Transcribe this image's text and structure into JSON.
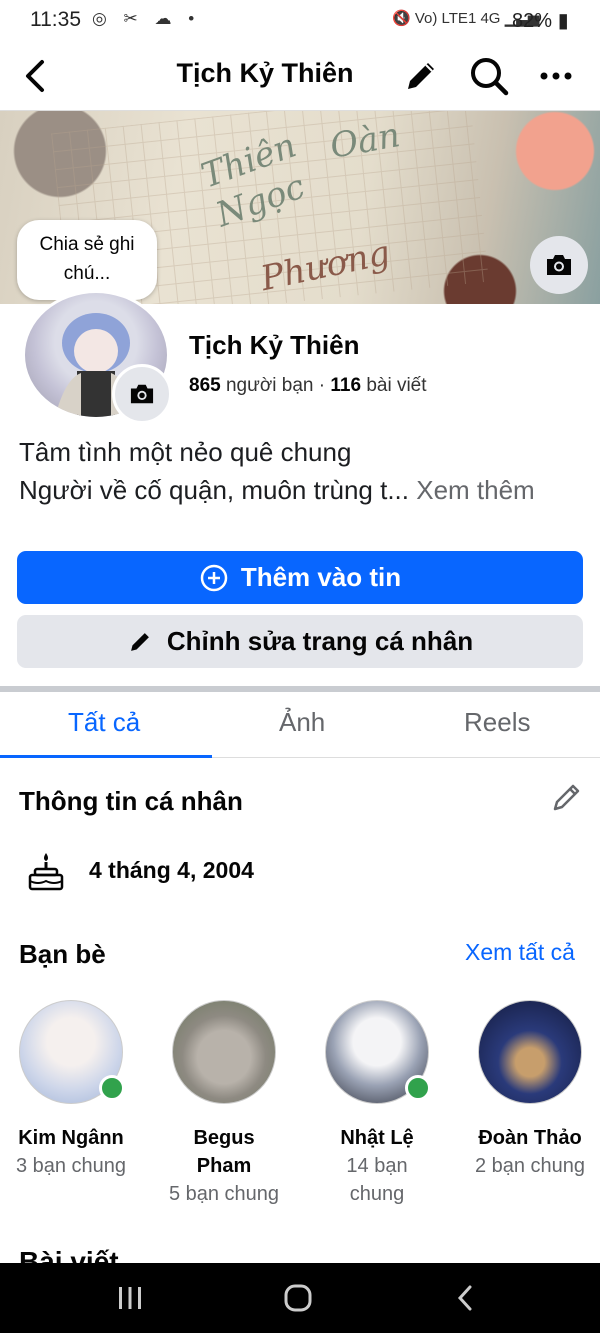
{
  "status_bar": {
    "time": "11:35",
    "left_icons": "◎ ✂ ☁ •",
    "network": "Vo) LTE1 4G",
    "battery": "82%"
  },
  "header": {
    "title": "Tịch Kỷ Thiên",
    "back_icon": "chevron-left-icon",
    "edit_icon": "pencil-icon",
    "search_icon": "search-icon",
    "more_icon": "more-dots-icon"
  },
  "cover": {
    "script_words": [
      "Thiên",
      "Ngọc",
      "Oàn",
      "Phương"
    ]
  },
  "note_bubble": {
    "line1": "Chia sẻ ghi",
    "line2": "chú..."
  },
  "profile": {
    "name": "Tịch Kỷ Thiên",
    "friends_count": "865",
    "friends_label": " người bạn · ",
    "posts_count": "116",
    "posts_label": " bài viết"
  },
  "bio": {
    "line1": "Tâm tình một nẻo quê chung",
    "line2": "Người về cố quận, muôn trùng t...",
    "see_more": " Xem thêm"
  },
  "actions": {
    "add_story": "Thêm vào tin",
    "edit_profile": "Chỉnh sửa trang cá nhân"
  },
  "tabs": [
    {
      "label": "Tất cả",
      "active": true
    },
    {
      "label": "Ảnh",
      "active": false
    },
    {
      "label": "Reels",
      "active": false
    }
  ],
  "personal_info": {
    "title": "Thông tin cá nhân",
    "birthday": "4 tháng 4, 2004"
  },
  "friends": {
    "title": "Bạn bè",
    "see_all": "Xem tất cả",
    "items": [
      {
        "name": "Kim Ngânn",
        "mutual": "3 bạn chung",
        "online": true
      },
      {
        "name": "Begus Pham",
        "mutual": "5 bạn chung",
        "online": false
      },
      {
        "name": "Nhật Lệ",
        "mutual": "14 bạn chung",
        "online": true
      },
      {
        "name": "Đoàn Thảo",
        "mutual": "2 bạn chung",
        "online": false
      }
    ]
  },
  "next_section": "Bài viết",
  "colors": {
    "accent": "#0866ff",
    "secondary_button": "#e4e6eb",
    "online": "#31a24c"
  }
}
